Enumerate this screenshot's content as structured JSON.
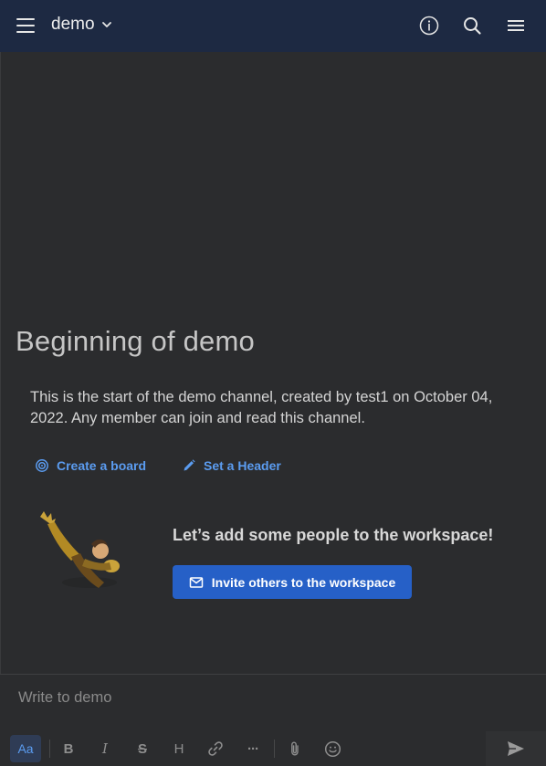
{
  "header": {
    "channel_name": "demo",
    "icons": [
      "menu-icon",
      "chevron-down-icon",
      "info-icon",
      "search-icon",
      "list-menu-icon"
    ]
  },
  "intro": {
    "title": "Beginning of demo",
    "description": "This is the start of the demo channel, created by test1 on October 04, 2022. Any member can join and read this channel.",
    "actions": [
      {
        "label": "Create a board",
        "icon": "target-icon"
      },
      {
        "label": "Set a Header",
        "icon": "pencil-icon"
      }
    ]
  },
  "invite": {
    "heading": "Let’s add some people to the workspace!",
    "button_label": "Invite others to the workspace",
    "button_icon": "mail-icon"
  },
  "composer": {
    "placeholder": "Write to demo",
    "format_label": "Aa",
    "bold_label": "B",
    "italic_label": "I",
    "strike_label": "S",
    "heading_label": "H",
    "more_label": "···"
  },
  "colors": {
    "header_bg": "#1d2942",
    "background": "#2b2c2e",
    "link": "#5b9cf0",
    "primary_button": "#2660c7"
  }
}
